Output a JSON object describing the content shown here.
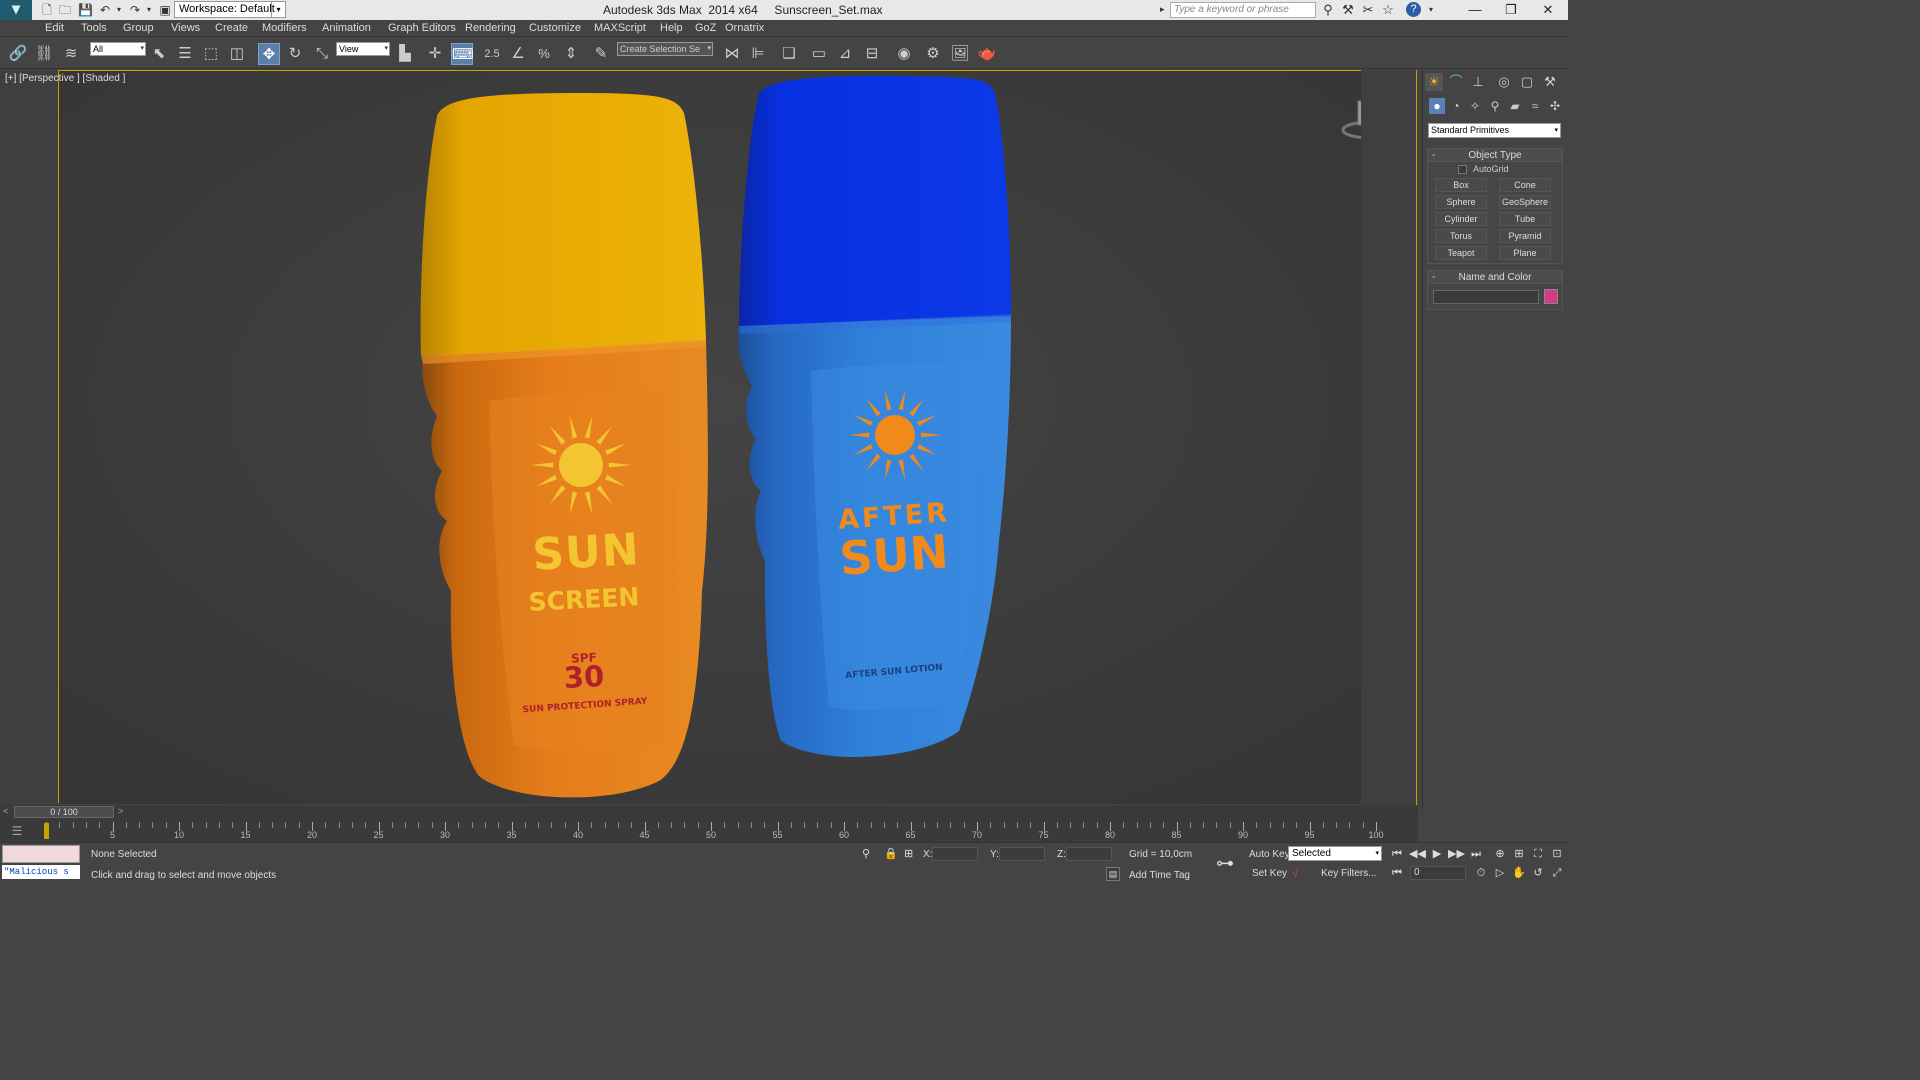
{
  "window": {
    "workspace": "Workspace: Default",
    "title": "Autodesk 3ds Max  2014 x64     Sunscreen_Set.max",
    "search_placeholder": "Type a keyword or phrase"
  },
  "menu": [
    "Edit",
    "Tools",
    "Group",
    "Views",
    "Create",
    "Modifiers",
    "Animation",
    "Graph Editors",
    "Rendering",
    "Customize",
    "MAXScript",
    "Help",
    "GoZ",
    "Ornatrix"
  ],
  "toolbar": {
    "selection_filter": "All",
    "ref_coord": "View",
    "named_selection": "Create Selection Se",
    "angle_snap": "2.5",
    "percent_snap": "%"
  },
  "viewport": {
    "label": "[+] [Perspective ] [Shaded ]",
    "sunscreen": {
      "line1": "SUN",
      "line2": "SCREEN",
      "spf_label": "SPF",
      "spf_value": "30",
      "caption": "SUN PROTECTION SPRAY",
      "body_color": "#e07a1a",
      "cap_color": "#e8a800",
      "text_color": "#f3c531"
    },
    "aftersun": {
      "line1": "AFTER",
      "line2": "SUN",
      "caption": "AFTER SUN LOTION",
      "body_color": "#2e7fd8",
      "cap_color": "#0a2fe0",
      "text_color": "#f08a1a"
    }
  },
  "command_panel": {
    "category": "Standard Primitives",
    "object_type_title": "Object Type",
    "autogrid_label": "AutoGrid",
    "autogrid_checked": false,
    "primitives": [
      "Box",
      "Cone",
      "Sphere",
      "GeoSphere",
      "Cylinder",
      "Tube",
      "Torus",
      "Pyramid",
      "Teapot",
      "Plane"
    ],
    "name_color_title": "Name and Color",
    "object_name": "",
    "object_color": "#d83a8a"
  },
  "timeline": {
    "slider_label": "0 / 100",
    "current_frame": 0,
    "frame_count": 100,
    "tick_labels": [
      "0",
      "5",
      "10",
      "15",
      "20",
      "25",
      "30",
      "35",
      "40",
      "45",
      "50",
      "55",
      "60",
      "65",
      "70",
      "75",
      "80",
      "85",
      "90",
      "95",
      "100"
    ]
  },
  "status": {
    "listener": "\"Malicious s",
    "selection": "None Selected",
    "prompt": "Click and drag to select and move objects",
    "x_label": "X:",
    "y_label": "Y:",
    "z_label": "Z:",
    "x_value": "",
    "y_value": "",
    "z_value": "",
    "grid": "Grid = 10,0cm",
    "add_time_tag": "Add Time Tag",
    "auto_key": "Auto Key",
    "set_key": "Set Key",
    "key_mode": "Selected",
    "key_filters": "Key Filters...",
    "frame": "0"
  }
}
